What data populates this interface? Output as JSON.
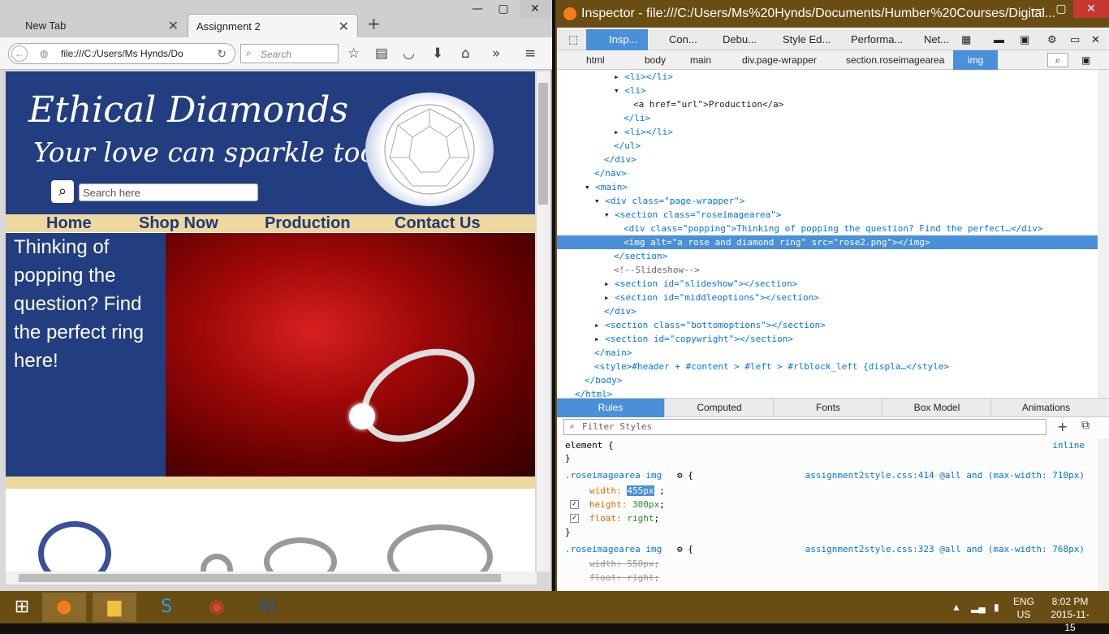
{
  "browser": {
    "tabs": [
      "New Tab",
      "Assignment 2"
    ],
    "url": "file:///C:/Users/Ms Hynds/Do",
    "search_placeholder": "Search"
  },
  "site": {
    "brand_line1": "Ethical Diamonds",
    "brand_line2": "Your love can sparkle too!",
    "search_placeholder": "Search here",
    "nav": [
      "Home",
      "Shop Now",
      "Production",
      "Contact Us"
    ],
    "popping_text": "Thinking of popping the question? Find the perfect ring here!"
  },
  "devtools": {
    "title": "Inspector - file:///C:/Users/Ms%20Hynds/Documents/Humber%20Courses/Digital...",
    "toolbar": [
      "Insp...",
      "Con...",
      "Debu...",
      "Style Ed...",
      "Performa...",
      "Net..."
    ],
    "breadcrumbs": [
      "html",
      "body",
      "main",
      "div.page-wrapper",
      "section.roseimagearea",
      "img"
    ],
    "panel_tabs": [
      "Rules",
      "Computed",
      "Fonts",
      "Box Model",
      "Animations"
    ],
    "filter_placeholder": "Filter Styles",
    "tree": [
      "<li></li>",
      "<li>",
      "<a href=\"url\">Production</a>",
      "</li>",
      "<li></li>",
      "</ul>",
      "</div>",
      "</nav>",
      "<main>",
      "<div class=\"page-wrapper\">",
      "<section class=\"roseimagearea\">",
      "<div class=\"popping\">Thinking of popping the question? Find the perfect…</div>",
      "<img alt=\"a rose and diamond ring\" src=\"rose2.png\"></img>",
      "</section>",
      "<!--Slideshow-->",
      "<section id=\"slideshow\"></section>",
      "<section id=\"middleoptions\"></section>",
      "</div>",
      "<section class=\"bottomoptions\"></section>",
      "<section id=\"copywright\"></section>",
      "</main>",
      "<style>#header + #content > #left > #rlblock_left {displa…</style>",
      "</body>",
      "</html>"
    ],
    "rules": {
      "element_selector": "element {",
      "element_src": "inline",
      "close": "}",
      "r1_selector": ".roseimagearea img",
      "r1_src": "assignment2style.css:414 @all and (max-width: 710px)",
      "r1_width_prop": "width:",
      "r1_width_val": "455px",
      "r1_height_prop": "height:",
      "r1_height_val": "300px",
      "r1_float_prop": "float:",
      "r1_float_val": "right",
      "r2_selector": ".roseimagearea img",
      "r2_src": "assignment2style.css:323 @all and (max-width: 768px)",
      "r2_width": "width: 550px;",
      "r2_float": "float: right;"
    }
  },
  "tray": {
    "lang1": "ENG",
    "lang2": "US",
    "time": "8:02 PM",
    "date": "2015-11-15"
  }
}
